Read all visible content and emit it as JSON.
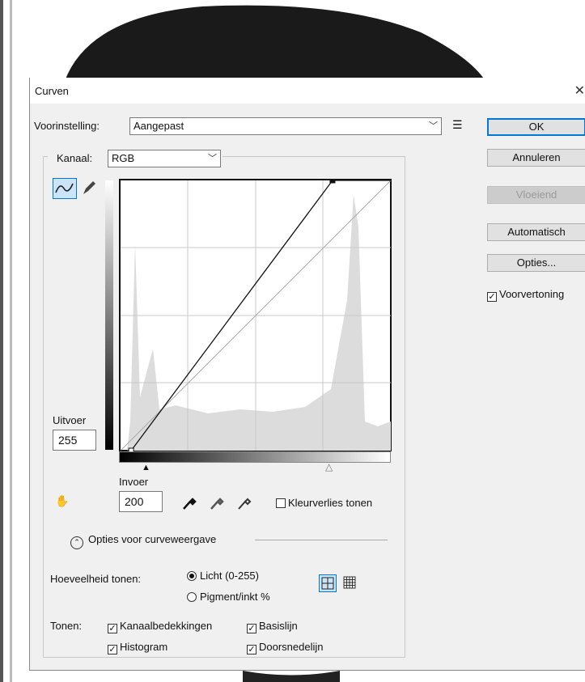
{
  "dialog": {
    "title": "Curven",
    "close_glyph": "✕",
    "preset_label": "Voorinstelling:",
    "preset_value": "Aangepast",
    "channel_label": "Kanaal:",
    "channel_value": "RGB"
  },
  "buttons": {
    "ok": "OK",
    "cancel": "Annuleren",
    "smooth": "Vloeiend",
    "auto": "Automatisch",
    "options": "Opties..."
  },
  "preview": {
    "label": "Voorvertoning",
    "checked": true
  },
  "curve": {
    "output_label": "Uitvoer",
    "output_value": "255",
    "input_label": "Invoer",
    "input_value": "200",
    "clipping_label": "Kleurverlies tonen",
    "points": [
      [
        0,
        0
      ],
      [
        10,
        0
      ],
      [
        200,
        255
      ],
      [
        255,
        255
      ]
    ]
  },
  "display_options": {
    "header": "Opties voor curveweergave",
    "amount_label": "Hoeveelheid tonen:",
    "light_label": "Licht (0-255)",
    "pigment_label": "Pigment/inkt %",
    "show_label": "Tonen:",
    "channel_overlays": "Kanaalbedekkingen",
    "baseline": "Basislijn",
    "histogram": "Histogram",
    "intersection": "Doorsnedelijn"
  },
  "colors": {
    "accent": "#0078d7",
    "panel": "#f0f0f0",
    "watermark": "#000000"
  }
}
